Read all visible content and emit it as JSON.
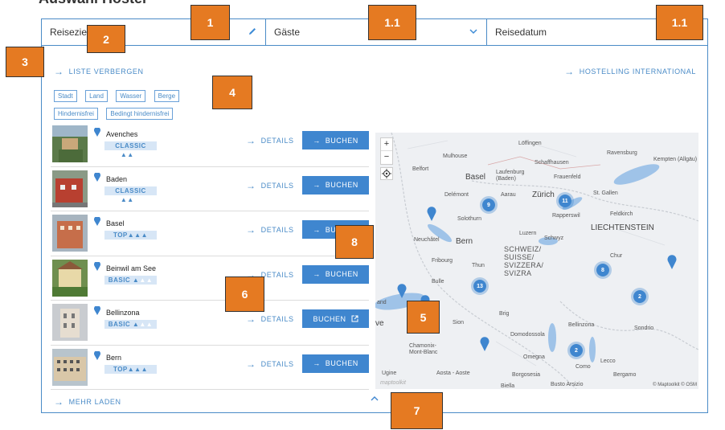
{
  "page": {
    "heading_fragment": "Auswahl Hostel"
  },
  "search_bar": {
    "destination_label": "Reiseziel",
    "guests_label": "Gäste",
    "date_label": "Reisedatum"
  },
  "links": {
    "hide_list": "LISTE VERBERGEN",
    "hostelling_international": "HOSTELLING INTERNATIONAL",
    "load_more": "MEHR LADEN"
  },
  "filters": [
    "Stadt",
    "Land",
    "Wasser",
    "Berge",
    "Hindernisfrei",
    "Bedingt hindernisfrei"
  ],
  "hostels": [
    {
      "name": "Avenches",
      "category": "CLASSIC",
      "stars": "▲▲",
      "stars_empty": "▲",
      "details": "DETAILS",
      "book": "BUCHEN",
      "external": false
    },
    {
      "name": "Baden",
      "category": "CLASSIC",
      "stars": "▲▲",
      "stars_empty": "▲",
      "details": "DETAILS",
      "book": "BUCHEN",
      "external": false
    },
    {
      "name": "Basel",
      "category": "TOP",
      "stars": "▲▲▲",
      "stars_empty": "",
      "details": "DETAILS",
      "book": "BUCHEN",
      "external": false
    },
    {
      "name": "Beinwil am See",
      "category": "BASIC",
      "stars": "▲",
      "stars_empty": "▲▲",
      "details": "DETAILS",
      "book": "BUCHEN",
      "external": false
    },
    {
      "name": "Bellinzona",
      "category": "BASIC",
      "stars": "▲",
      "stars_empty": "▲▲",
      "details": "DETAILS",
      "book": "BUCHEN",
      "external": true
    },
    {
      "name": "Bern",
      "category": "TOP",
      "stars": "▲▲▲",
      "stars_empty": "",
      "details": "DETAILS",
      "book": "BUCHEN",
      "external": false
    }
  ],
  "map": {
    "zoom_in": "+",
    "zoom_out": "−",
    "attribution": "© Maptoolkit © OSM",
    "watermark": "maptoolkit",
    "big_labels": {
      "zurich": "Zürich",
      "bern": "Bern",
      "liechtenstein": "LIECHTENSTEIN"
    },
    "country_name": [
      "SCHWEIZ/",
      "SUISSE/",
      "SVIZZERA/",
      "SVIZRA"
    ],
    "places": {
      "loffingen": "Löffingen",
      "mulhouse": "Mulhouse",
      "schaffhausen": "Schaffhausen",
      "ravensburg": "Ravensburg",
      "kempten": "Kempten (Allgäu)",
      "belfort": "Belfort",
      "basel": "Basel",
      "laufenburg": "Laufenburg (Baden)",
      "frauenfeld": "Frauenfeld",
      "delemont": "Delémont",
      "aarau": "Aarau",
      "stgallen": "St. Gallen",
      "solothurn": "Solothurn",
      "rapperswil": "Rapperswil",
      "feldkirch": "Feldkirch",
      "neuchatel": "Neuchâtel",
      "luzern": "Luzern",
      "schwyz": "Schwyz",
      "fribourg": "Fribourg",
      "thun": "Thun",
      "chur": "Chur",
      "bulle": "Bulle",
      "brig": "Brig",
      "sion": "Sion",
      "bellinzona": "Bellinzona",
      "sondrio": "Sondrio",
      "domodossola": "Domodossola",
      "chamonix": "Chamonix-Mont-Blanc",
      "omegna": "Omegna",
      "lecco": "Lecco",
      "como": "Como",
      "ugine": "Ugine",
      "aosta": "Aosta - Aoste",
      "borgosesia": "Borgosesia",
      "bergamo": "Bergamo",
      "biella": "Biella",
      "busto": "Busto Arsizio",
      "geneve_fragment": "ve",
      "lausanne_fragment": "and"
    },
    "clusters": [
      "9",
      "11",
      "8",
      "13",
      "2",
      "2"
    ]
  },
  "annotations": [
    "1",
    "1.1",
    "1.1",
    "2",
    "3",
    "4",
    "5",
    "6",
    "7",
    "8"
  ],
  "colors": {
    "accent": "#3f86cf",
    "border": "#4a8bc7",
    "badge_bg": "#d7e6f6",
    "annotation": "#e57a22"
  }
}
